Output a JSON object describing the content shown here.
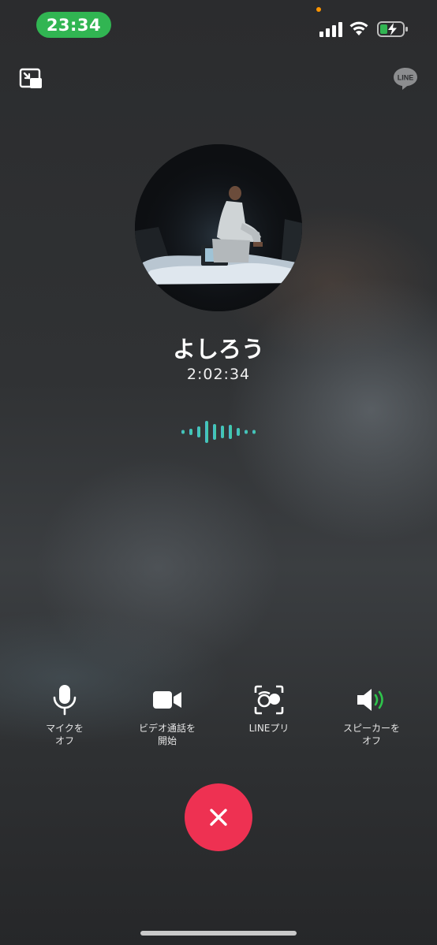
{
  "status_bar": {
    "time": "23:34",
    "battery_state": "charging",
    "recording_indicator_color": "#ff9500"
  },
  "header": {
    "pip_icon": "picture-in-picture-icon",
    "brand_logo": "LINE"
  },
  "call": {
    "caller_name": "よしろう",
    "duration": "2:02:34"
  },
  "controls": [
    {
      "id": "mic",
      "icon": "microphone-icon",
      "label": "マイクを\nオフ"
    },
    {
      "id": "video",
      "icon": "video-camera-icon",
      "label": "ビデオ通話を\n開始"
    },
    {
      "id": "filter",
      "icon": "face-filter-icon",
      "label": "LINEプリ"
    },
    {
      "id": "speaker",
      "icon": "speaker-icon",
      "label": "スピーカーを\nオフ"
    }
  ],
  "end_call": {
    "icon": "close-icon"
  },
  "colors": {
    "status_time_bg": "#31b552",
    "end_call_bg": "#ee3152",
    "waveform_teal": "#3fc3a7",
    "speaker_accent": "#2ec44b"
  }
}
